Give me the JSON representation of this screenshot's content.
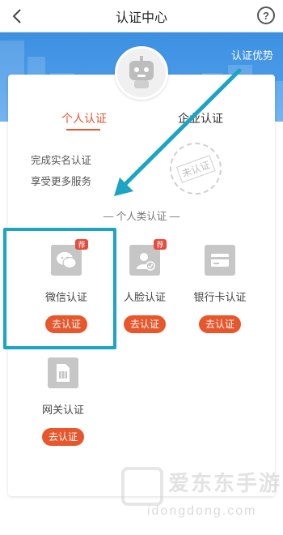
{
  "header": {
    "title": "认证中心",
    "help_symbol": "?"
  },
  "banner": {
    "advantage_link": "认证优势"
  },
  "tabs": {
    "personal": "个人认证",
    "enterprise": "企业认证"
  },
  "description": {
    "line1": "完成实名认证",
    "line2": "享受更多服务"
  },
  "stamp": {
    "text": "未认证"
  },
  "section": {
    "title": "— 个人类认证 —"
  },
  "methods": [
    {
      "label": "微信认证",
      "button": "去认证",
      "badge": "荐"
    },
    {
      "label": "人脸认证",
      "button": "去认证",
      "badge": "荐"
    },
    {
      "label": "银行卡认证",
      "button": "去认证"
    },
    {
      "label": "网关认证",
      "button": "去认证"
    }
  ],
  "watermark": {
    "text": "爱东东手游",
    "sub": "idongdong.com"
  },
  "colors": {
    "accent": "#e8562c",
    "banner": "#4a9cea",
    "highlight": "#1da4c4",
    "arrow": "#1da4c4"
  }
}
